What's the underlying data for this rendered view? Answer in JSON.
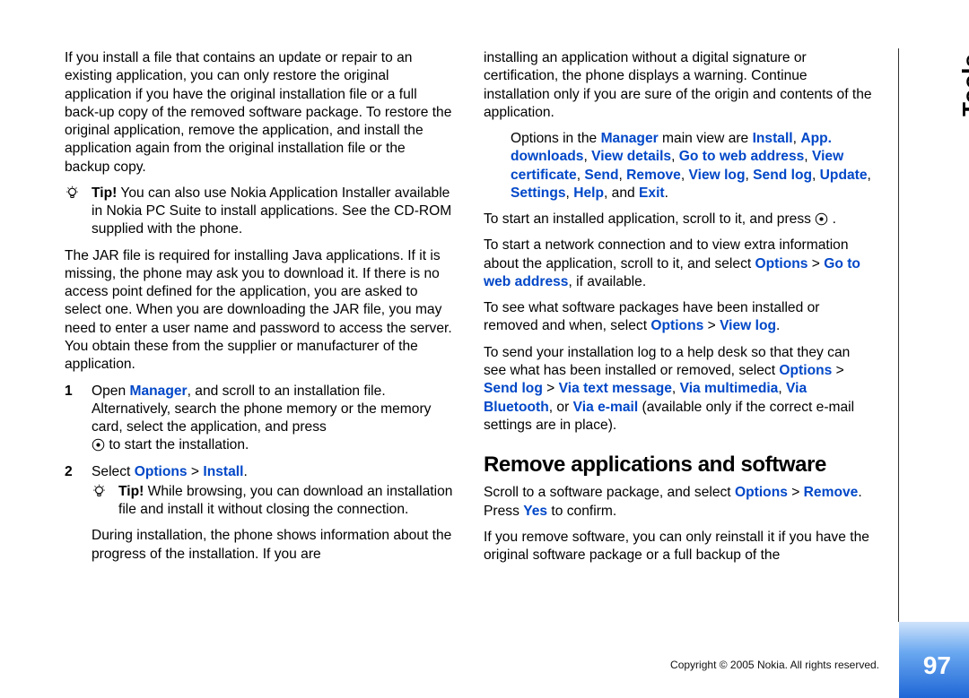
{
  "side_title": "Tools",
  "page_number": "97",
  "copyright": "Copyright © 2005 Nokia. All rights reserved.",
  "c1": {
    "p1": "If you install a file that contains an update or repair to an existing application, you can only restore the original application if you have the original installation file or a full back-up copy of the removed software package. To restore the original application, remove the application, and install the application again from the original installation file or the backup copy.",
    "tip1_label": "Tip!",
    "tip1_body": " You can also use Nokia Application Installer available in Nokia PC Suite to install applications. See the CD-ROM supplied with the phone.",
    "p2": "The JAR file is required for installing Java applications. If it is missing, the phone may ask you to download it. If there is no access point defined for the application, you are asked to select one. When you are downloading the JAR file, you may need to enter a user name and password to access the server. You obtain these from the supplier or manufacturer of the application.",
    "ol1_num": "1",
    "ol1_a": "Open ",
    "ol1_link": "Manager",
    "ol1_b": ", and scroll to an installation file. Alternatively, search the phone memory or the memory card, select the application, and press ",
    "ol1_c": " to start the installation.",
    "ol2_num": "2",
    "ol2_a": "Select ",
    "ol2_opt": "Options",
    "ol2_gt": " > ",
    "ol2_install": "Install",
    "ol2_dot": ".",
    "tip2_label": "Tip!",
    "tip2_body": " While browsing, you can download an installation file and install it without closing the connection.",
    "ol2_p2": "During installation, the phone shows information about the progress of the installation. If you are"
  },
  "c2": {
    "p1": "installing an application without a digital signature or certification, the phone displays a warning. Continue installation only if you are sure of the origin and contents of the application.",
    "opts_a": "Options in the ",
    "opts_mgr": "Manager",
    "opts_b": " main view are ",
    "o_install": "Install",
    "o_app_dl": "App. downloads",
    "o_view_det": "View details",
    "o_goto": "Go to web address",
    "o_view_cert": "View certificate",
    "o_send": "Send",
    "o_remove": "Remove",
    "o_view_log": "View log",
    "o_send_log": "Send log",
    "o_update": "Update",
    "o_settings": "Settings",
    "o_help": "Help",
    "o_and": ", and ",
    "o_exit": "Exit",
    "p2_a": "To start an installed application, scroll to it, and press ",
    "p2_b": " .",
    "p3_a": "To start a network connection and to view extra information about the application, scroll to it, and select ",
    "p3_opt": "Options",
    "p3_gt": " > ",
    "p3_goto": "Go to web address",
    "p3_b": ", if available.",
    "p4_a": "To see what software packages have been installed or removed and when, select ",
    "p4_opt": "Options",
    "p4_gt": " > ",
    "p4_vl": "View log",
    "p4_b": ".",
    "p5_a": "To send your installation log to a help desk so that they can see what has been installed or removed, select ",
    "p5_opt": "Options",
    "p5_gt1": " > ",
    "p5_sl": "Send log",
    "p5_gt2": " > ",
    "p5_vtm": "Via text message",
    "p5_c1": ", ",
    "p5_vmm": "Via multimedia",
    "p5_c2": ", ",
    "p5_vbt": "Via Bluetooth",
    "p5_or": ", or ",
    "p5_vem": "Via e-mail",
    "p5_b": " (available only if the correct e-mail settings are in place).",
    "h2": "Remove applications and software",
    "r1_a": "Scroll to a software package, and select ",
    "r1_opt": "Options",
    "r1_gt": " > ",
    "r1_rem": "Remove",
    "r1_b": ". Press ",
    "r1_yes": "Yes",
    "r1_c": " to confirm.",
    "r2": "If you remove software, you can only reinstall it if you have the original software package or a full backup of the"
  }
}
